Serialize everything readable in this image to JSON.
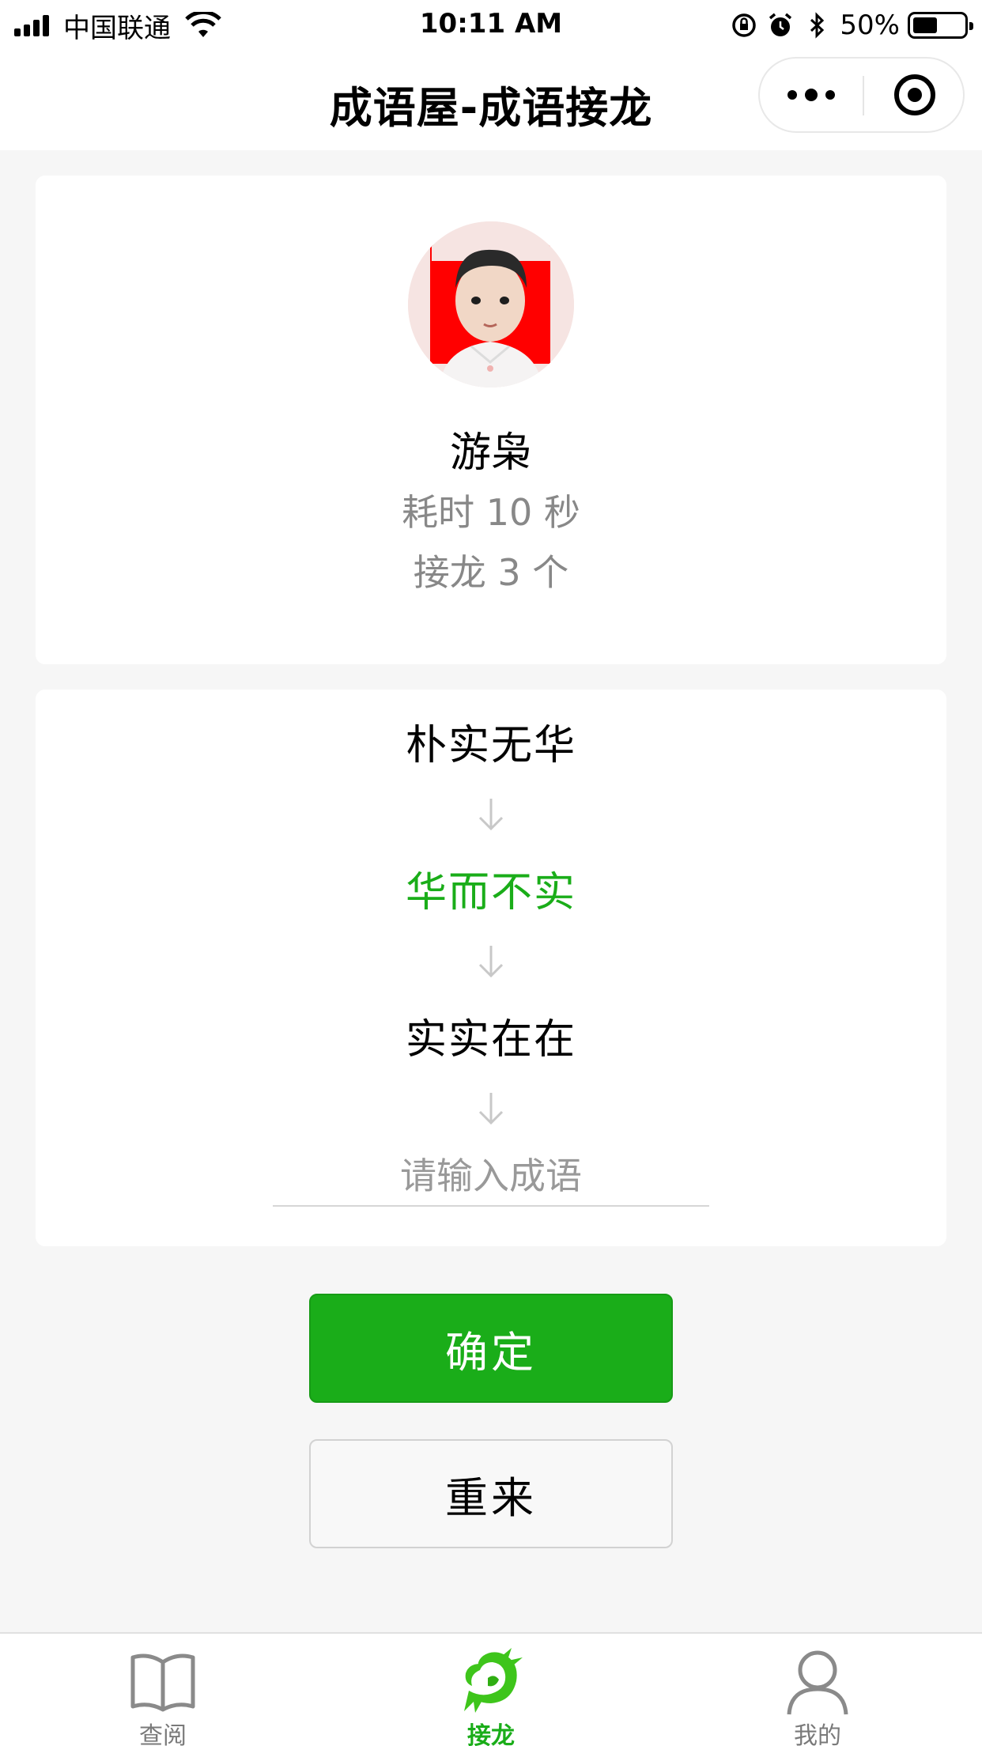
{
  "status_bar": {
    "carrier": "中国联通",
    "time": "10:11 AM",
    "battery_percent": "50%",
    "battery_level": 0.5,
    "icons": [
      "signal-icon",
      "wifi-icon",
      "orientation-lock-icon",
      "alarm-icon",
      "bluetooth-icon",
      "battery-icon"
    ]
  },
  "nav": {
    "title": "成语屋-成语接龙",
    "more_icon": "more-dots-icon",
    "close_icon": "target-close-icon"
  },
  "profile": {
    "name": "游枭",
    "time_used": "耗时 10 秒",
    "chain_count": "接龙 3 个"
  },
  "chain": {
    "idioms": [
      "朴实无华",
      "华而不实",
      "实实在在"
    ],
    "input_placeholder": "请输入成语",
    "input_value": "",
    "accent_color": "#1aad19"
  },
  "buttons": {
    "confirm": "确定",
    "restart": "重来"
  },
  "tabbar": {
    "items": [
      {
        "label": "查阅",
        "icon": "book-icon",
        "active": false
      },
      {
        "label": "接龙",
        "icon": "dragon-icon",
        "active": true
      },
      {
        "label": "我的",
        "icon": "person-icon",
        "active": false
      }
    ]
  }
}
